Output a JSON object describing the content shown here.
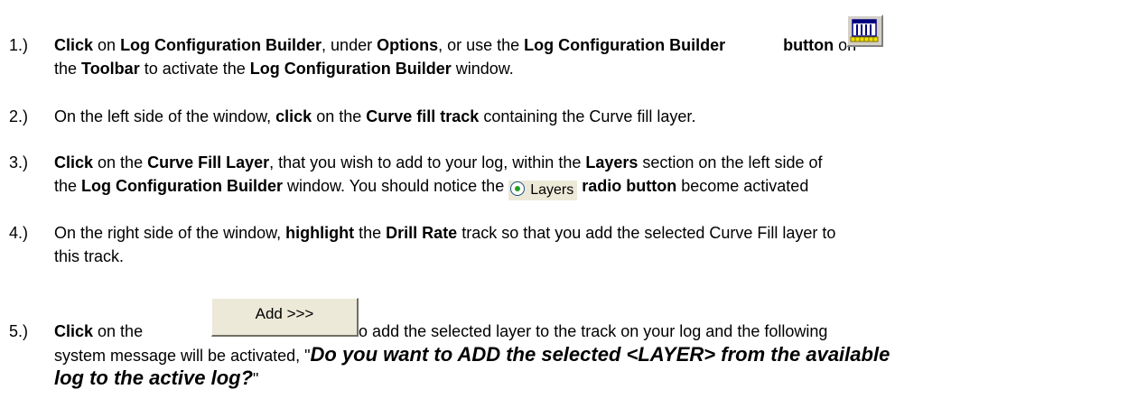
{
  "steps": [
    {
      "number": "1.)",
      "line1": {
        "s1": "Click",
        "s2": " on ",
        "s3": "Log Configuration Builder",
        "s4": ", under ",
        "s5": "Options",
        "s6": ", or use the ",
        "s7": "Log Configuration Builder",
        "s8": "button",
        "s9": " on"
      },
      "line2": {
        "s1": "the ",
        "s2": "Toolbar",
        "s3": " to activate the ",
        "s4": "Log Configuration Builder",
        "s5": " window."
      }
    },
    {
      "number": "2.)",
      "line1": {
        "s1": "On the left side of the window, ",
        "s2": "click",
        "s3": " on the ",
        "s4": "Curve fill track",
        "s5": " containing the Curve fill layer."
      }
    },
    {
      "number": "3.)",
      "line1": {
        "s1": "Click",
        "s2": " on the ",
        "s3": "Curve Fill Layer",
        "s4": ", that you wish to add to your log, within the ",
        "s5": "Layers",
        "s6": " section on the left side of"
      },
      "line2": {
        "s1": "the ",
        "s2": "Log Configuration Builder",
        "s3": " window. You should notice the ",
        "s4": "radio button",
        "s5": " become activated"
      },
      "layers_radio_label": "Layers"
    },
    {
      "number": "4.)",
      "line1": {
        "s1": "On the right side of the window, ",
        "s2": "highlight",
        "s3": " the ",
        "s4": "Drill Rate",
        "s5": " track so that you add the selected Curve Fill layer to"
      },
      "line2": {
        "s1": "this track."
      }
    },
    {
      "number": "5.)",
      "line1": {
        "s1": "Click",
        "s2": " on the",
        "s3": "button",
        "s4": " to add the selected layer to the track on your log and the following"
      },
      "line2": {
        "s1": "system message will be activated, \"",
        "s2": "Do you want to ADD the selected <LAYER> from the available"
      },
      "line3": {
        "s1": "log to the active log?",
        "s2": "\""
      },
      "add_button_label": "Add >>>"
    }
  ],
  "icons": {
    "log_config_builder": "log-configuration-builder-icon"
  }
}
